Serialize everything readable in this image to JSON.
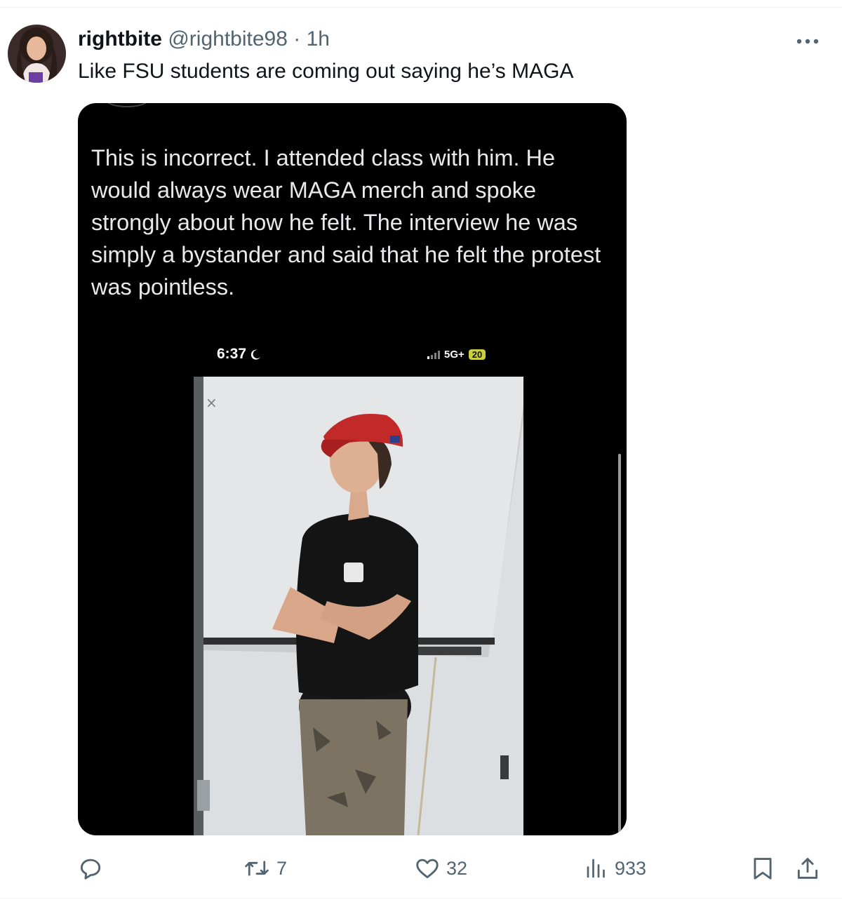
{
  "tweet": {
    "author": {
      "display_name": "rightbite",
      "handle": "@rightbite98",
      "separator": "·",
      "time": "1h"
    },
    "text": "Like FSU students are coming out saying he’s MAGA",
    "media": {
      "quoted_text": "This is incorrect. I attended class with him. He would always wear MAGA merch and spoke strongly about how he felt. The interview he was simply a bystander and said that he felt the protest was pointless.",
      "phone_status": {
        "time": "6:37",
        "network": "5G+",
        "battery": "20"
      }
    },
    "actions": {
      "reply_count": "",
      "retweet_count": "7",
      "like_count": "32",
      "view_count": "933"
    }
  },
  "icons": {
    "more": "more-horizontal-icon",
    "reply": "reply-icon",
    "retweet": "retweet-icon",
    "like": "heart-icon",
    "views": "views-chart-icon",
    "bookmark": "bookmark-icon",
    "share": "share-icon"
  },
  "colors": {
    "text_primary": "#0f1419",
    "text_secondary": "#536471",
    "media_background": "#000000"
  }
}
